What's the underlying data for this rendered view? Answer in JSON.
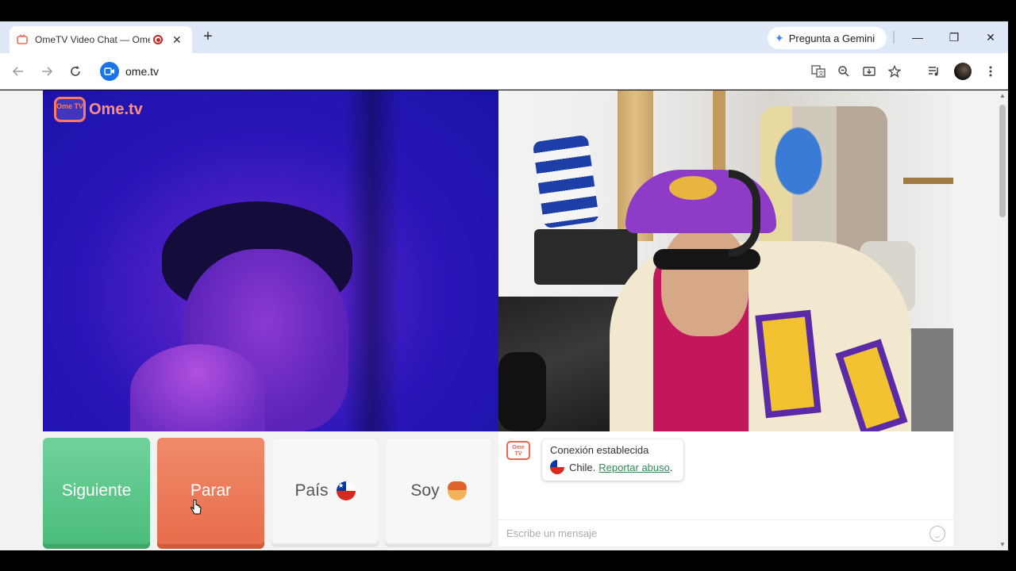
{
  "browser": {
    "tab_title": "OmeTV Video Chat — Ome",
    "tab_close": "✕",
    "new_tab": "+",
    "gemini_label": "Pregunta a Gemini",
    "url": "ome.tv",
    "window_controls": {
      "minimize": "—",
      "restore": "❐",
      "close": "✕"
    }
  },
  "page": {
    "logo_watermark": "Ome.tv",
    "logo_badge": "Ome TV",
    "buttons": {
      "next": "Siguiente",
      "stop": "Parar",
      "country": "País",
      "gender": "Soy"
    },
    "chat": {
      "status": "Conexión establecida",
      "country": "Chile.",
      "report": "Reportar abuso",
      "report_suffix": ".",
      "input_placeholder": "Escribe un mensaje"
    }
  },
  "colors": {
    "next_button": "#4cbd7c",
    "stop_button": "#e86e4d",
    "link": "#2e8b57",
    "brand": "#f0674f"
  },
  "icons": [
    "back-icon",
    "forward-icon",
    "reload-icon",
    "translate-icon",
    "zoom-icon",
    "install-icon",
    "star-icon",
    "media-icon",
    "profile-avatar",
    "menu-icon",
    "chile-flag-icon",
    "boy-emoji-icon",
    "smile-icon"
  ]
}
